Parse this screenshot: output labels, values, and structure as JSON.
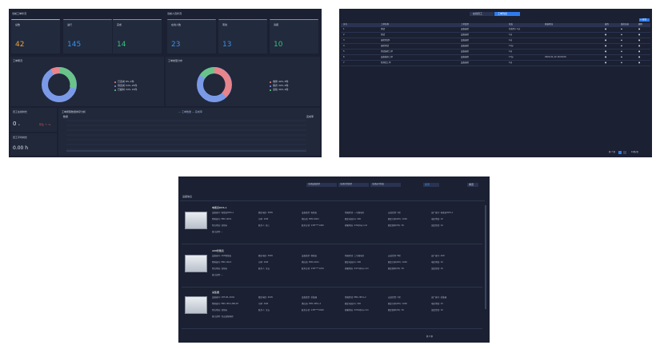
{
  "panel1": {
    "left_section_title": "当前工单状况",
    "right_section_title": "当前人员状况",
    "stats": [
      {
        "label": "总数",
        "value": "42",
        "color": "#e8a23c"
      },
      {
        "label": "进行",
        "value": "145",
        "color": "#3b8fe6"
      },
      {
        "label": "完成",
        "value": "14",
        "color": "#35c07a"
      },
      {
        "label": "在线人数",
        "value": "23",
        "color": "#3b8fe6"
      },
      {
        "label": "离线",
        "value": "13",
        "color": "#3b8fe6"
      },
      {
        "label": "请假",
        "value": "10",
        "color": "#35c07a"
      }
    ],
    "pie1_title": "工单概况",
    "pie2_title": "工单类型分布",
    "pie1_legend": [
      "已完成 8% 4件",
      "待完成 54% 25件",
      "已超时 34% 15件"
    ],
    "pie2_legend": [
      "维修 40% 8件",
      "保养 30% 6件",
      "巡检 30% 6件"
    ],
    "pie1_colors": [
      "#e8848c",
      "#7a9ae8",
      "#6ac48a"
    ],
    "pie2_colors": [
      "#e8848c",
      "#7a9ae8",
      "#6ac48a"
    ],
    "side1_title": "员工在线时长",
    "side1_value": "0",
    "side1_unit": "s",
    "side1_extra": "环比 ↑ -%",
    "side2_title": "员工平均时长",
    "side2_value": "0.00 h",
    "chart_title": "工单按照数量排序分析",
    "chart_legend": "— 工单数量  — 完成率",
    "chart_ylabel_left": "数量",
    "chart_ylabel_right": "完成率"
  },
  "panel2": {
    "tab_active": "工单列表",
    "tab_inactive": "在线员工",
    "add_button": "+ 新增",
    "headers": [
      "序号",
      "工单名称",
      "工单类型",
      "状态",
      "开始时间",
      "操作",
      "维修记录",
      "删除"
    ],
    "rows": [
      [
        "1",
        "测试",
        "设备巡检",
        "已签到 / 1分",
        "",
        "●",
        "◆",
        "●"
      ],
      [
        "2",
        "测试",
        "设备巡检",
        "1分",
        "",
        "●",
        "◆",
        "●"
      ],
      [
        "3",
        "巡检测试1",
        "设备巡检",
        "1分",
        "",
        "●",
        "◆",
        "●"
      ],
      [
        "4",
        "巡检测试",
        "设备巡检",
        "11分",
        "",
        "●",
        "◆",
        "●"
      ],
      [
        "5",
        "测试巡检工单",
        "设备巡检",
        "1分",
        "",
        "●",
        "◆",
        "●"
      ],
      [
        "6",
        "设备维修工单",
        "设备巡检",
        "17分",
        "2022-01-12 10:00:00",
        "●",
        "◆",
        "●"
      ],
      [
        "7",
        "新测试工单",
        "设备巡检",
        "1分",
        "",
        "●",
        "◆",
        "●"
      ]
    ],
    "pagination": "共 7 条",
    "page_size": "10条/页"
  },
  "panel3": {
    "filters": [
      "全部设备类型",
      "全部告警类型",
      "全部运行状态"
    ],
    "search_button": "搜索",
    "reset_button": "重置",
    "section_title": "设备信息",
    "devices": [
      {
        "name": "电能表DDS-1",
        "fields": [
          [
            "设备编号: 电能表DDS-1",
            "额定电压: 380V",
            "设备类型: 电能表",
            "所属区域: 一号配电房",
            "安装位置: A区",
            "出厂编号: 电能表DDS-1"
          ],
          [
            "物料编号: PMC-0001",
            "功率: 1KW",
            "供应商: PMC-0001",
            "额定电流(A): 400",
            "额定功率(kW): 1000",
            "电压等级: 10"
          ],
          [
            "所在地址: 深圳市",
            "联系人: 张三",
            "联系方式: 138****1463",
            "邮箱地址: 234@qq.com",
            "额定频率(Hz): 50",
            "温度传感: 10"
          ],
          [
            "备注说明: --"
          ]
        ]
      },
      {
        "name": "AK8智能表",
        "fields": [
          [
            "设备编号: AK8智能表",
            "额定电压: 380V",
            "设备类型: 智能表",
            "所属区域: 二号配电房",
            "安装位置: B区",
            "出厂编号: AK8"
          ],
          [
            "物料编号: PMC-0021",
            "功率: 1KW",
            "供应商: PMC-0021",
            "额定电流(A): 400",
            "额定功率(kW): 1000",
            "电压等级: 10"
          ],
          [
            "所在地址: 深圳市",
            "联系人: 王五",
            "联系方式: 136****1234",
            "邮箱地址: 3471@qq.com",
            "额定频率(Hz): 50",
            "温度传感: 10"
          ],
          [
            "备注说明: --"
          ]
        ]
      },
      {
        "name": "采集器",
        "fields": [
          [
            "设备编号: CET-WL-3002",
            "额定电压: 400V",
            "设备类型: 采集器",
            "所属区域: PMC-3PCL-2",
            "安装位置: C区",
            "出厂编号: 采集器"
          ],
          [
            "物料编号: PMC-3PCL-NB-2H",
            "功率: 1KW",
            "供应商: PMC-3PCL-2",
            "额定电流(A): 400",
            "额定功率(kW): 1000",
            "电压等级: 10"
          ],
          [
            "所在地址: 深圳市",
            "联系人: 王五",
            "联系方式: 138****0000",
            "邮箱地址: 3254@qq.com",
            "额定频率(Hz): 50",
            "温度传感: 10"
          ],
          [
            "备注说明: 已安装配电柜"
          ]
        ]
      }
    ],
    "pagination": "共 3 条"
  }
}
